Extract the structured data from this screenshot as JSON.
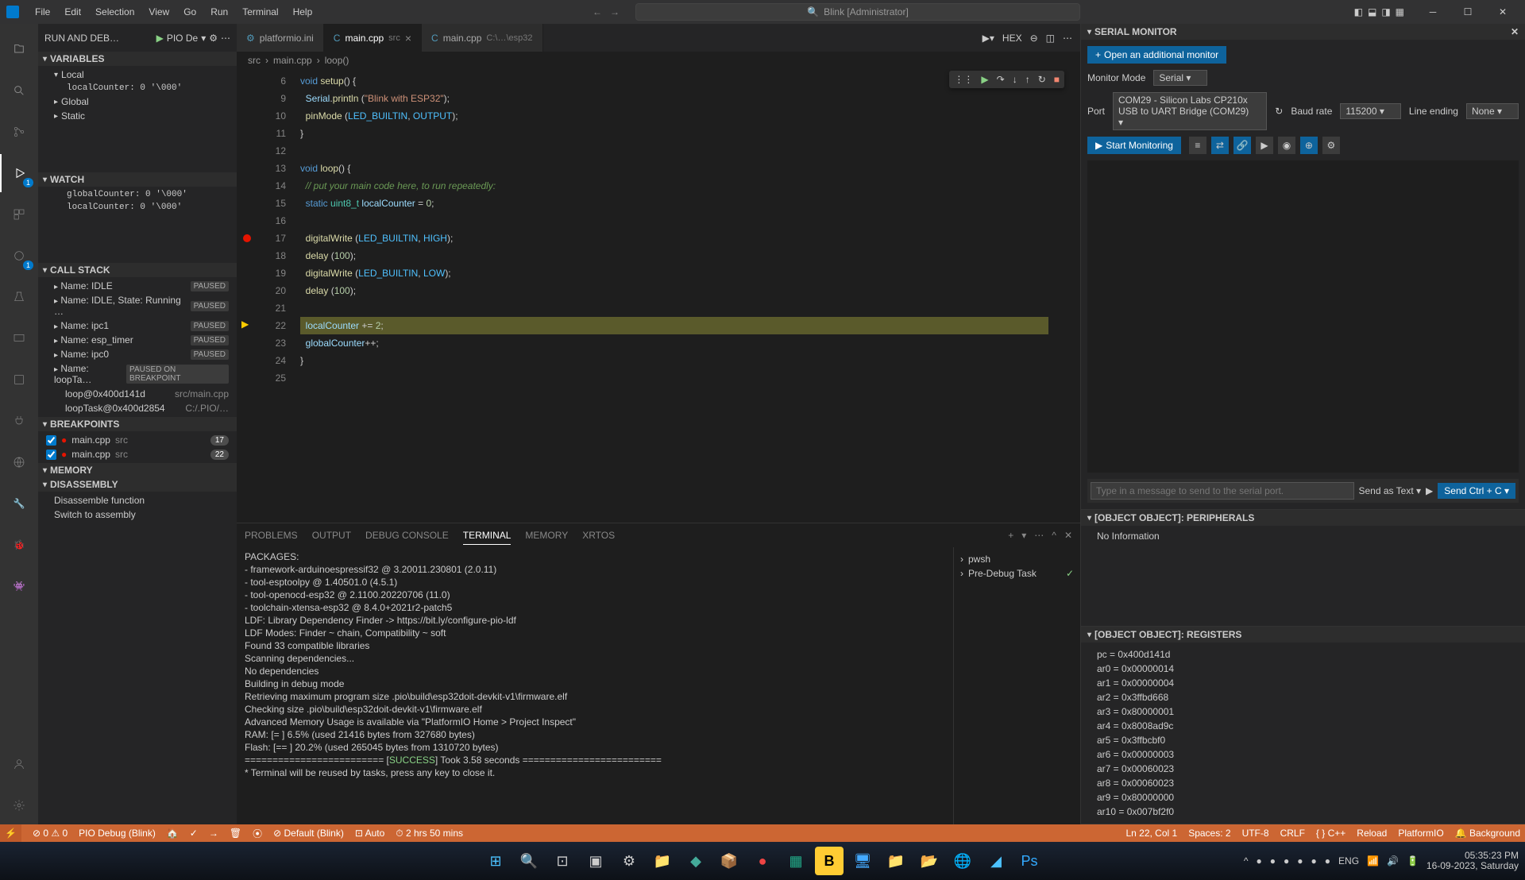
{
  "title": "Blink [Administrator]",
  "menus": [
    "File",
    "Edit",
    "Selection",
    "View",
    "Go",
    "Run",
    "Terminal",
    "Help"
  ],
  "sidebar": {
    "runHeader": "RUN AND DEB…",
    "configName": "PIO De",
    "sections": {
      "variables": "VARIABLES",
      "watch": "WATCH",
      "callstack": "CALL STACK",
      "breakpoints": "BREAKPOINTS",
      "memory": "MEMORY",
      "disassembly": "DISASSEMBLY"
    },
    "varLocal": "Local",
    "varGlobal": "Global",
    "varStatic": "Static",
    "localCounterVar": "localCounter: 0 '\\000'",
    "watchItems": [
      "globalCounter: 0 '\\000'",
      "localCounter: 0 '\\000'"
    ],
    "callstack": [
      {
        "name": "Name: IDLE",
        "status": "PAUSED"
      },
      {
        "name": "Name: IDLE, State: Running …",
        "status": "PAUSED"
      },
      {
        "name": "Name: ipc1",
        "status": "PAUSED"
      },
      {
        "name": "Name: esp_timer",
        "status": "PAUSED"
      },
      {
        "name": "Name: ipc0",
        "status": "PAUSED"
      },
      {
        "name": "Name: loopTa…",
        "status": "PAUSED ON BREAKPOINT"
      }
    ],
    "stackFrames": [
      {
        "fn": "loop@0x400d141d",
        "loc": "src/main.cpp"
      },
      {
        "fn": "loopTask@0x400d2854",
        "loc": "C:/.PIO/…"
      }
    ],
    "breakpoints": [
      {
        "file": "main.cpp",
        "dir": "src",
        "badge": "17"
      },
      {
        "file": "main.cpp",
        "dir": "src",
        "badge": "22"
      }
    ],
    "disasm": [
      "Disassemble function",
      "Switch to assembly"
    ]
  },
  "tabs": [
    {
      "icon": "⚙",
      "name": "platformio.ini",
      "active": false,
      "close": false
    },
    {
      "icon": "C",
      "name": "main.cpp",
      "suffix": "src",
      "active": true,
      "close": true
    },
    {
      "icon": "C",
      "name": "main.cpp",
      "suffix": "C:\\…\\esp32",
      "active": false,
      "close": false
    }
  ],
  "breadcrumbs": [
    "src",
    "main.cpp",
    "loop()"
  ],
  "hex": "HEX",
  "code": {
    "lines": [
      {
        "n": 6,
        "html": "<span class='kw'>void</span> <span class='fn'>setup</span>() {"
      },
      {
        "n": 9,
        "html": "  <span class='var'>Serial</span>.<span class='fn'>println</span> (<span class='str'>\"Blink with ESP32\"</span>);"
      },
      {
        "n": 10,
        "html": "  <span class='fn'>pinMode</span> (<span class='const'>LED_BUILTIN</span>, <span class='const'>OUTPUT</span>);"
      },
      {
        "n": 11,
        "html": "}"
      },
      {
        "n": 12,
        "html": ""
      },
      {
        "n": 13,
        "html": "<span class='kw'>void</span> <span class='fn'>loop</span>() {"
      },
      {
        "n": 14,
        "html": "  <span class='cm'>// put your main code here, to run repeatedly:</span>"
      },
      {
        "n": 15,
        "html": "  <span class='kw'>static</span> <span class='type'>uint8_t</span> <span class='var'>localCounter</span> = <span class='num'>0</span>;"
      },
      {
        "n": 16,
        "html": ""
      },
      {
        "n": 17,
        "html": "  <span class='fn'>digitalWrite</span> (<span class='const'>LED_BUILTIN</span>, <span class='const'>HIGH</span>);",
        "bp": true
      },
      {
        "n": 18,
        "html": "  <span class='fn'>delay</span> (<span class='num'>100</span>);"
      },
      {
        "n": 19,
        "html": "  <span class='fn'>digitalWrite</span> (<span class='const'>LED_BUILTIN</span>, <span class='const'>LOW</span>);"
      },
      {
        "n": 20,
        "html": "  <span class='fn'>delay</span> (<span class='num'>100</span>);"
      },
      {
        "n": 21,
        "html": ""
      },
      {
        "n": 22,
        "html": "  <span class='var'>localCounter</span> += <span class='num'>2</span>;",
        "cur": true,
        "hl": true
      },
      {
        "n": 23,
        "html": "  <span class='var'>globalCounter</span>++;"
      },
      {
        "n": 24,
        "html": "}"
      },
      {
        "n": 25,
        "html": ""
      }
    ]
  },
  "panel": {
    "tabs": [
      "PROBLEMS",
      "OUTPUT",
      "DEBUG CONSOLE",
      "TERMINAL",
      "MEMORY",
      "XRTOS"
    ],
    "active": "TERMINAL",
    "terminalLines": [
      "PACKAGES:",
      " - framework-arduinoespressif32 @ 3.20011.230801 (2.0.11)",
      " - tool-esptoolpy @ 1.40501.0 (4.5.1)",
      " - tool-openocd-esp32 @ 2.1100.20220706 (11.0)",
      " - toolchain-xtensa-esp32 @ 8.4.0+2021r2-patch5",
      "LDF: Library Dependency Finder -> https://bit.ly/configure-pio-ldf",
      "LDF Modes: Finder ~ chain, Compatibility ~ soft",
      "Found 33 compatible libraries",
      "Scanning dependencies...",
      "No dependencies",
      "Building in debug mode",
      "Retrieving maximum program size .pio\\build\\esp32doit-devkit-v1\\firmware.elf",
      "Checking size .pio\\build\\esp32doit-devkit-v1\\firmware.elf",
      "Advanced Memory Usage is available via \"PlatformIO Home > Project Inspect\"",
      "RAM:   [=         ]   6.5% (used 21416 bytes from 327680 bytes)",
      "Flash: [==        ]  20.2% (used 265045 bytes from 1310720 bytes)",
      "========================= [SUCCESS] Took 3.58 seconds =========================",
      " *  Terminal will be reused by tasks, press any key to close it."
    ],
    "termList": [
      {
        "icon": "›",
        "name": "pwsh"
      },
      {
        "icon": "›",
        "name": "Pre-Debug Task",
        "check": true
      }
    ]
  },
  "serial": {
    "header": "SERIAL MONITOR",
    "openBtn": "Open an additional monitor",
    "modeLabel": "Monitor Mode",
    "modeVal": "Serial",
    "portLabel": "Port",
    "portVal": "COM29 - Silicon Labs CP210x USB to UART Bridge (COM29)",
    "baudLabel": "Baud rate",
    "baudVal": "115200",
    "lineEndLabel": "Line ending",
    "lineEndVal": "None",
    "startBtn": "Start Monitoring",
    "inputPlaceholder": "Type in a message to send to the serial port.",
    "sendAs": "Send as Text",
    "sendCtrl": "Send Ctrl + C"
  },
  "periph": {
    "header": "[OBJECT OBJECT]: PERIPHERALS",
    "body": "No Information"
  },
  "registers": {
    "header": "[OBJECT OBJECT]: REGISTERS",
    "items": [
      "pc = 0x400d141d",
      "ar0 = 0x00000014",
      "ar1 = 0x00000004",
      "ar2 = 0x3ffbd668",
      "ar3 = 0x80000001",
      "ar4 = 0x8008ad9c",
      "ar5 = 0x3ffbcbf0",
      "ar6 = 0x00000003",
      "ar7 = 0x00060023",
      "ar8 = 0x00060023",
      "ar9 = 0x80000000",
      "ar10 = 0x007bf2f0"
    ]
  },
  "statusbar": {
    "left": [
      "⊘ 0 ⚠ 0",
      "PIO Debug (Blink)",
      "🏠",
      "✓",
      "→",
      "🗑",
      "⦿",
      "⊘ Default (Blink)",
      "⊡ Auto",
      "⏱ 2 hrs 50 mins"
    ],
    "right": [
      "Ln 22, Col 1",
      "Spaces: 2",
      "UTF-8",
      "CRLF",
      "{ } C++",
      "Reload",
      "PlatformIO",
      "🔔 Background"
    ]
  },
  "taskbar": {
    "time": "05:35:23 PM",
    "date": "16-09-2023, Saturday"
  }
}
